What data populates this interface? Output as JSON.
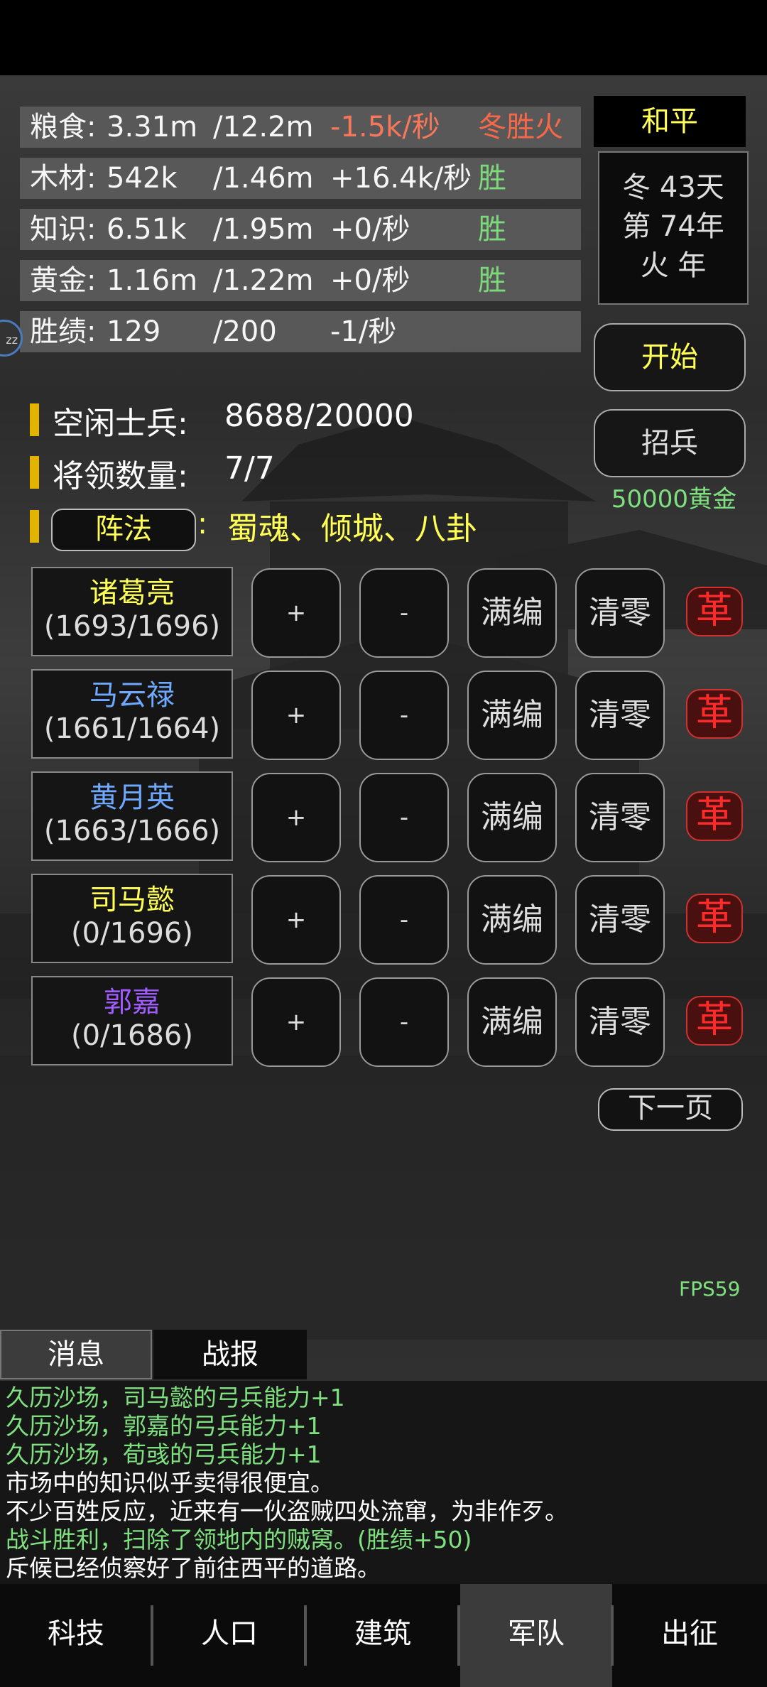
{
  "resources": [
    {
      "name": "粮食:",
      "current": "3.31m",
      "max": "/12.2m",
      "rate": "-1.5k/秒",
      "tag": "冬胜火",
      "tag_color": "#ff6a4a",
      "rate_color": "#ff7a5c"
    },
    {
      "name": "木材:",
      "current": "542k",
      "max": "/1.46m",
      "rate": "+16.4k/秒",
      "tag": "胜",
      "tag_color": "#7fe07f",
      "rate_color": "#ffffff"
    },
    {
      "name": "知识:",
      "current": "6.51k",
      "max": "/1.95m",
      "rate": "+0/秒",
      "tag": "胜",
      "tag_color": "#7fe07f",
      "rate_color": "#ffffff"
    },
    {
      "name": "黄金:",
      "current": "1.16m",
      "max": "/1.22m",
      "rate": "+0/秒",
      "tag": "胜",
      "tag_color": "#7fe07f",
      "rate_color": "#ffffff"
    },
    {
      "name": "胜绩:",
      "current": "129",
      "max": "/200",
      "rate": "-1/秒",
      "tag": "",
      "tag_color": "#7fe07f",
      "rate_color": "#ffffff"
    }
  ],
  "status": {
    "peace": "和平",
    "season_day": "冬 43天",
    "year": "第 74年",
    "element_year": "火 年"
  },
  "buttons": {
    "start": "开始",
    "recruit": "招兵",
    "recruit_cost": "50000黄金",
    "next_page": "下一页",
    "formation": "阵法"
  },
  "army": {
    "idle_label": "空闲士兵:",
    "idle_value": "8688/20000",
    "generals_label": "将领数量:",
    "generals_value": "7/7",
    "formation_colon": ":",
    "formation_list": "蜀魂、倾城、八卦"
  },
  "generals": [
    {
      "name": "诸葛亮",
      "count": "(1693/1696)",
      "color": "#ffff55"
    },
    {
      "name": "马云禄",
      "count": "(1661/1664)",
      "color": "#6fa8ff"
    },
    {
      "name": "黄月英",
      "count": "(1663/1666)",
      "color": "#6fa8ff"
    },
    {
      "name": "司马懿",
      "count": "(0/1696)",
      "color": "#ffff55"
    },
    {
      "name": "郭嘉",
      "count": "(0/1686)",
      "color": "#a05cff"
    }
  ],
  "general_buttons": {
    "plus": "+",
    "minus": "-",
    "full": "满编",
    "clear": "清零",
    "ge": "革"
  },
  "fps": "FPS59",
  "tabs": {
    "messages": "消息",
    "battle_report": "战报"
  },
  "log": [
    {
      "text": "久历沙场，司马懿的弓兵能力+1",
      "color": "#7fe07f"
    },
    {
      "text": "久历沙场，郭嘉的弓兵能力+1",
      "color": "#7fe07f"
    },
    {
      "text": "久历沙场，荀彧的弓兵能力+1",
      "color": "#7fe07f"
    },
    {
      "text": "市场中的知识似乎卖得很便宜。",
      "color": "#ffffff"
    },
    {
      "text": "不少百姓反应，近来有一伙盗贼四处流窜，为非作歹。",
      "color": "#ffffff"
    },
    {
      "text": "战斗胜利，扫除了领地内的贼窝。(胜绩+50)",
      "color": "#7fe07f"
    },
    {
      "text": "斥候已经侦察好了前往西平的道路。",
      "color": "#ffffff"
    }
  ],
  "nav": [
    {
      "label": "科技",
      "active": false
    },
    {
      "label": "人口",
      "active": false
    },
    {
      "label": "建筑",
      "active": false
    },
    {
      "label": "军队",
      "active": true
    },
    {
      "label": "出征",
      "active": false
    }
  ],
  "side_badge": "zz"
}
